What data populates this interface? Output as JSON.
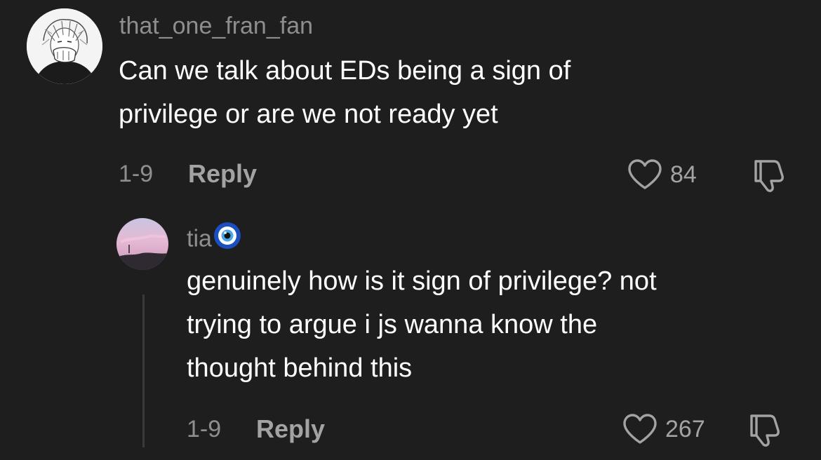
{
  "comment": {
    "username": "that_one_fran_fan",
    "text_lines": [
      "Can we talk about EDs being a sign of",
      "privilege or are we not ready yet"
    ],
    "date": "1-9",
    "reply_label": "Reply",
    "like_count": "84",
    "avatar_icon": "manga-drawing-avatar",
    "like_icon": "heart-outline-icon",
    "dislike_icon": "thumbs-down-outline-icon"
  },
  "reply": {
    "username": "tia",
    "username_emoji": "nazar-amulet-emoji",
    "text_lines": [
      "genuinely how is it sign of privilege? not",
      "trying to argue i js wanna know the",
      "thought behind this"
    ],
    "date": "1-9",
    "reply_label": "Reply",
    "like_count": "267",
    "avatar_icon": "pink-sky-photo-avatar",
    "like_icon": "heart-outline-icon",
    "dislike_icon": "thumbs-down-outline-icon"
  },
  "colors": {
    "background": "#1e1e1e",
    "primary_text": "#ffffff",
    "secondary_text": "#8e8e8e",
    "action_text": "#a3a3a3",
    "thread_line": "#3a3a3a"
  }
}
